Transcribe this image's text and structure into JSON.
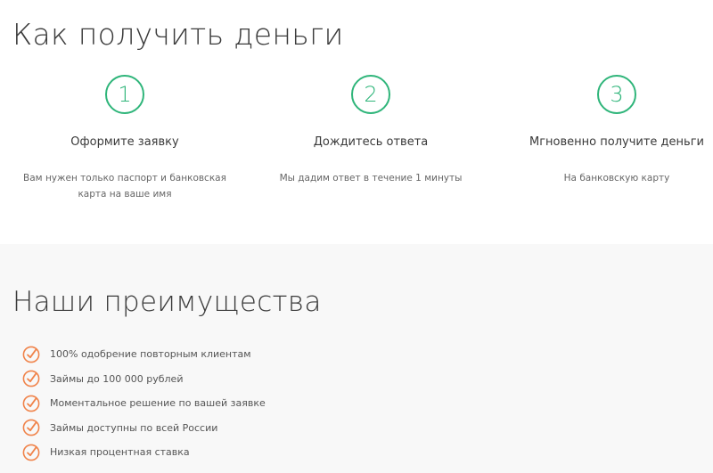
{
  "how": {
    "title": "Как получить деньги",
    "steps": [
      {
        "number": "1",
        "title": "Оформите заявку",
        "description": "Вам нужен только паспорт и банковская карта на ваше имя"
      },
      {
        "number": "2",
        "title": "Дождитесь ответа",
        "description": "Мы дадим ответ в течение 1 минуты"
      },
      {
        "number": "3",
        "title": "Мгновенно получите деньги",
        "description": "На банковскую карту"
      }
    ]
  },
  "advantages": {
    "title": "Наши преимущества",
    "items": [
      {
        "icon": "check-circle-icon",
        "text": "100% одобрение повторным клиентам"
      },
      {
        "icon": "check-circle-icon",
        "text": "Займы до 100 000 рублей"
      },
      {
        "icon": "check-circle-icon",
        "text": "Моментальное решение по вашей заявке"
      },
      {
        "icon": "check-circle-icon",
        "text": "Займы доступны по всей России"
      },
      {
        "icon": "check-circle-icon",
        "text": "Низкая процентная ставка"
      }
    ]
  },
  "colors": {
    "step_accent": "#2fb57a",
    "check_accent": "#f0834a",
    "section_bg": "#f8f8f8"
  }
}
